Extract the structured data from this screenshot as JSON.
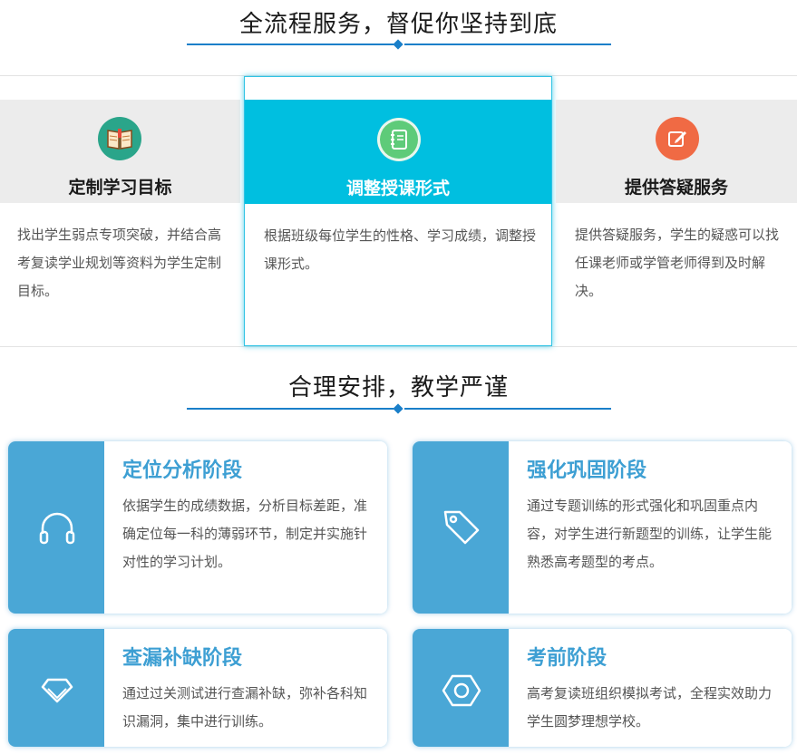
{
  "sections": {
    "service_title": "全流程服务，督促你坚持到底",
    "arrange_title": "合理安排，教学严谨"
  },
  "services": [
    {
      "title": "定制学习目标",
      "text": "找出学生弱点专项突破，并结合高考复读学业规划等资料为学生定制目标。",
      "icon": "book-icon",
      "icon_color": "#2aa58a"
    },
    {
      "title": "调整授课形式",
      "text": "根据班级每位学生的性格、学习成绩，调整授课形式。",
      "icon": "notebook-icon",
      "icon_color": "#5ecb79"
    },
    {
      "title": "提供答疑服务",
      "text": "提供答疑服务，学生的疑惑可以找任课老师或学管老师得到及时解决。",
      "icon": "edit-icon",
      "icon_color": "#f06a44"
    }
  ],
  "stages": [
    {
      "title": "定位分析阶段",
      "text": "依据学生的成绩数据，分析目标差距，准确定位每一科的薄弱环节，制定并实施针对性的学习计划。",
      "icon": "headphones-icon"
    },
    {
      "title": "强化巩固阶段",
      "text": "通过专题训练的形式强化和巩固重点内容，对学生进行新题型的训练，让学生能熟悉高考题型的考点。",
      "icon": "tag-icon"
    },
    {
      "title": "查漏补缺阶段",
      "text": "通过过关测试进行查漏补缺，弥补各科知识漏洞，集中进行训练。",
      "icon": "diamond-icon"
    },
    {
      "title": "考前阶段",
      "text": "高考复读班组织模拟考试，全程实效助力学生圆梦理想学校。",
      "icon": "hex-nut-icon"
    }
  ],
  "colors": {
    "accent": "#1a7fc9",
    "active": "#00bfe0",
    "stage_side": "#4aa7d6",
    "stage_title": "#3d9fd3"
  }
}
